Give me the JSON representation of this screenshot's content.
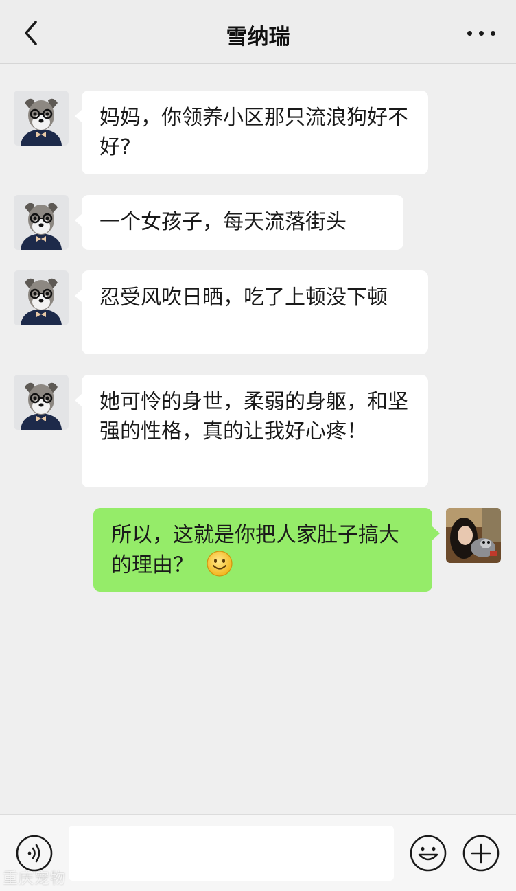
{
  "header": {
    "title": "雪纳瑞",
    "back_icon": "chevron-left-icon",
    "more_icon": "more-dots-icon"
  },
  "messages": [
    {
      "side": "left",
      "text": "妈妈，你领养小区那只流浪狗好不好?"
    },
    {
      "side": "left",
      "text": "一个女孩子，每天流落街头"
    },
    {
      "side": "left",
      "text": "忍受风吹日晒，吃了上顿没下顿"
    },
    {
      "side": "left",
      "text": "她可怜的身世，柔弱的身躯，和坚强的性格，真的让我好心疼！"
    },
    {
      "side": "right",
      "text": "所以，这就是你把人家肚子搞大的理由？",
      "emoji": "smile-emoji"
    }
  ],
  "input": {
    "value": "",
    "placeholder": "",
    "voice_icon": "voice-icon",
    "emoji_icon": "emoji-icon",
    "plus_icon": "plus-icon"
  },
  "watermark": "重庆宠物"
}
